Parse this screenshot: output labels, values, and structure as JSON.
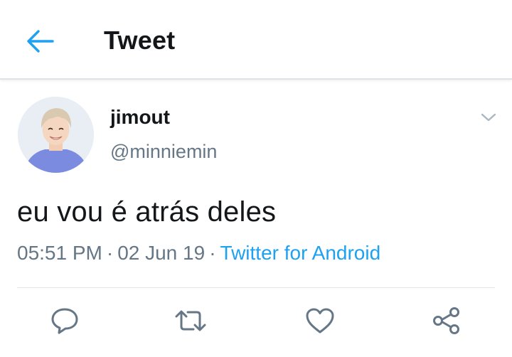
{
  "header": {
    "title": "Tweet",
    "back_icon": "arrow-left-icon",
    "accent_color": "#1da1f2"
  },
  "tweet": {
    "author": {
      "display_name": "jimout",
      "handle": "@minniemin",
      "avatar_icon": "avatar-photo"
    },
    "menu_icon": "chevron-down-icon",
    "text": "eu vou é atrás deles",
    "time": "05:51 PM",
    "date": "02 Jun 19",
    "separator": "·",
    "source": "Twitter for Android"
  },
  "actions": [
    {
      "name": "reply",
      "icon": "reply-icon"
    },
    {
      "name": "retweet",
      "icon": "retweet-icon"
    },
    {
      "name": "like",
      "icon": "heart-icon"
    },
    {
      "name": "share",
      "icon": "share-icon"
    }
  ],
  "colors": {
    "text_primary": "#14171a",
    "text_secondary": "#657786",
    "link": "#1da1f2",
    "icon_gray": "#657786"
  }
}
